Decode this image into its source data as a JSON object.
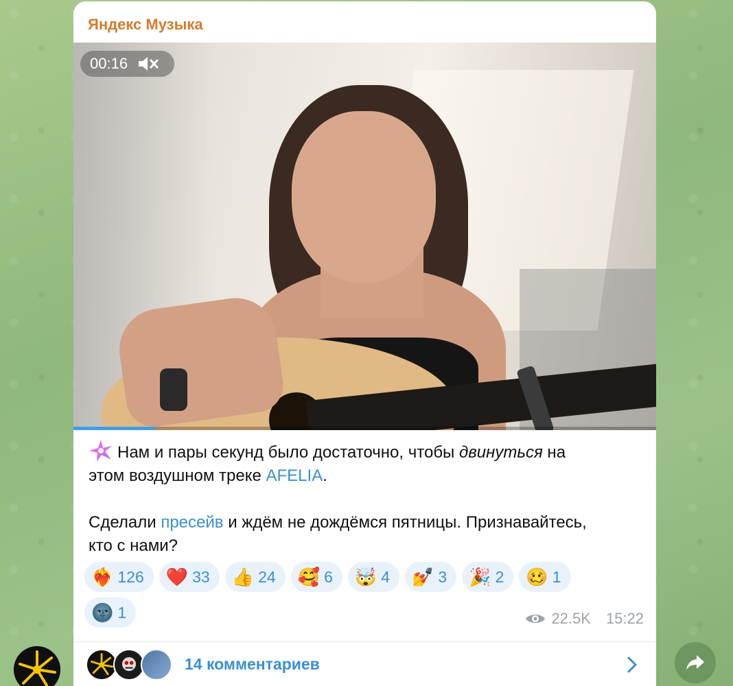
{
  "channel": {
    "name": "Яндекс Музыка"
  },
  "video": {
    "time": "00:16",
    "progress_fraction": 0.14
  },
  "caption": {
    "line1_text": "Нам и пары секунд было достаточно, чтобы ",
    "line1_italic": "двинуться",
    "line1_after": " на",
    "line2_text": "этом воздушном треке ",
    "line2_link": "AFELIA",
    "line2_end": ".",
    "para2_before": "Сделали ",
    "para2_link": "пресейв",
    "para2_after": " и ждём не дождёмся пятницы. Признавайтесь,",
    "para2_line2": "кто с нами?"
  },
  "reactions": [
    {
      "emoji": "❤️‍🔥",
      "count": "126"
    },
    {
      "emoji": "❤️",
      "count": "33"
    },
    {
      "emoji": "👍",
      "count": "24"
    },
    {
      "emoji": "🥰",
      "count": "6"
    },
    {
      "emoji": "🤯",
      "count": "4"
    },
    {
      "emoji": "💅",
      "count": "3"
    },
    {
      "emoji": "🎉",
      "count": "2"
    },
    {
      "emoji": "🥴",
      "count": "1"
    },
    {
      "emoji": "🌚",
      "count": "1"
    }
  ],
  "meta": {
    "views": "22.5K",
    "time": "15:22"
  },
  "comments": {
    "label": "14 комментариев"
  },
  "colors": {
    "link": "#3a8fd4",
    "channel_name": "#d57b2e",
    "reaction_bg": "#e9f2fb",
    "meta": "#9aa3ab"
  }
}
